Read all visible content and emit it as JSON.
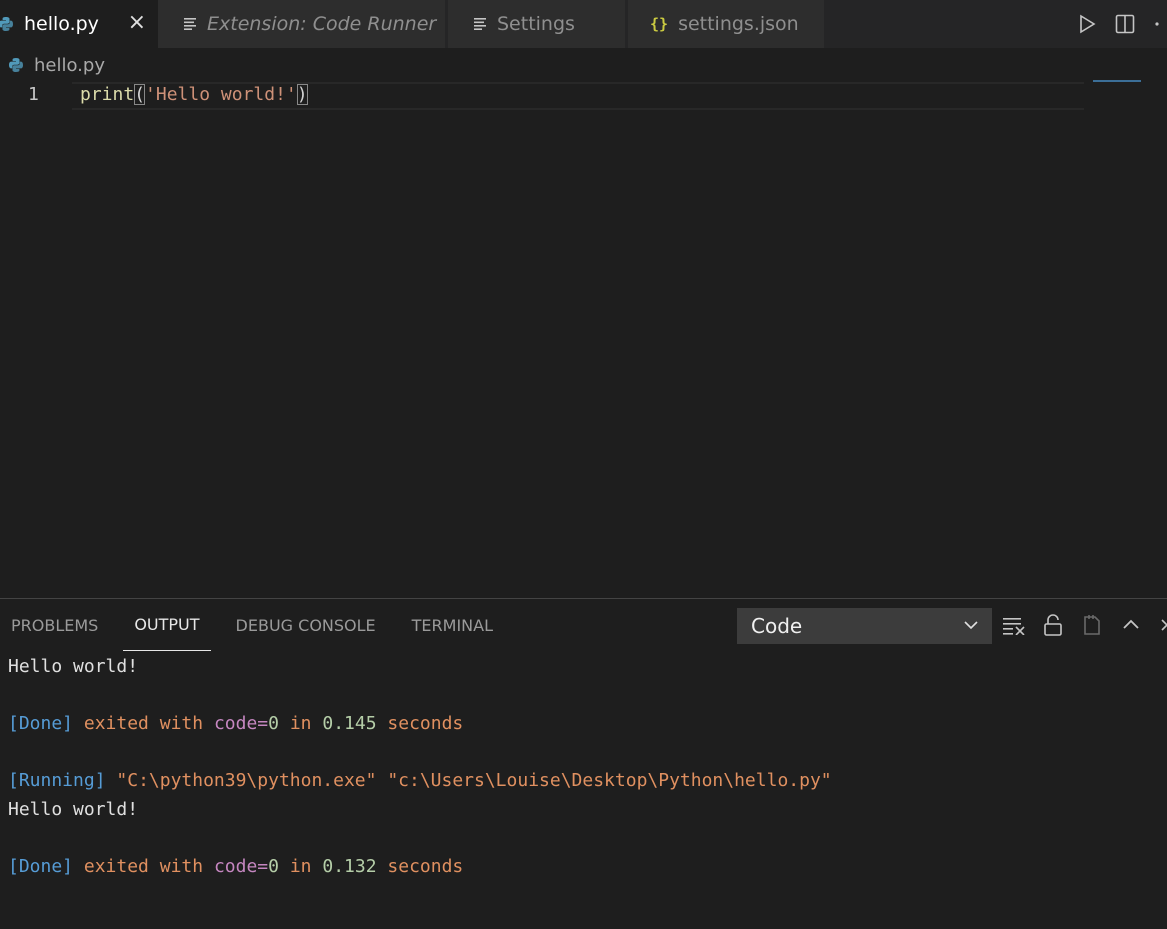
{
  "tabs": [
    {
      "label": "hello.py",
      "active": true,
      "icon": "python-icon"
    },
    {
      "label": "Extension: Code Runner",
      "active": false,
      "icon": "lines-icon"
    },
    {
      "label": "Settings",
      "active": false,
      "icon": "lines-icon"
    },
    {
      "label": "settings.json",
      "active": false,
      "icon": "json-braces-icon"
    }
  ],
  "json_icon_glyph": "{}",
  "close_glyph": "×",
  "breadcrumb": {
    "file": "hello.py"
  },
  "editor": {
    "line_number": "1",
    "code": {
      "fn": "print",
      "open": "(",
      "string": "'Hello world!'",
      "close": ")"
    }
  },
  "panel": {
    "tabs": [
      "PROBLEMS",
      "OUTPUT",
      "DEBUG CONSOLE",
      "TERMINAL"
    ],
    "active_tab": "OUTPUT",
    "channel_select": "Code"
  },
  "output": {
    "line1": "Hello world!",
    "done1": {
      "tag": "[Done]",
      "exited": "exited",
      "with": "with",
      "code": "code=",
      "code_val": "0",
      "in": "in",
      "time": "0.145",
      "unit": "seconds"
    },
    "running": {
      "tag": "[Running]",
      "cmd": "\"C:\\python39\\python.exe\" \"c:\\Users\\Louise\\Desktop\\Python\\hello.py\""
    },
    "line2": "Hello world!",
    "done2": {
      "tag": "[Done]",
      "exited": "exited",
      "with": "with",
      "code": "code=",
      "code_val": "0",
      "in": "in",
      "time": "0.132",
      "unit": "seconds"
    }
  },
  "colors": {
    "editor_bg": "#1e1e1e",
    "tabbar_bg": "#252526",
    "accent_blue": "#569cd6"
  }
}
